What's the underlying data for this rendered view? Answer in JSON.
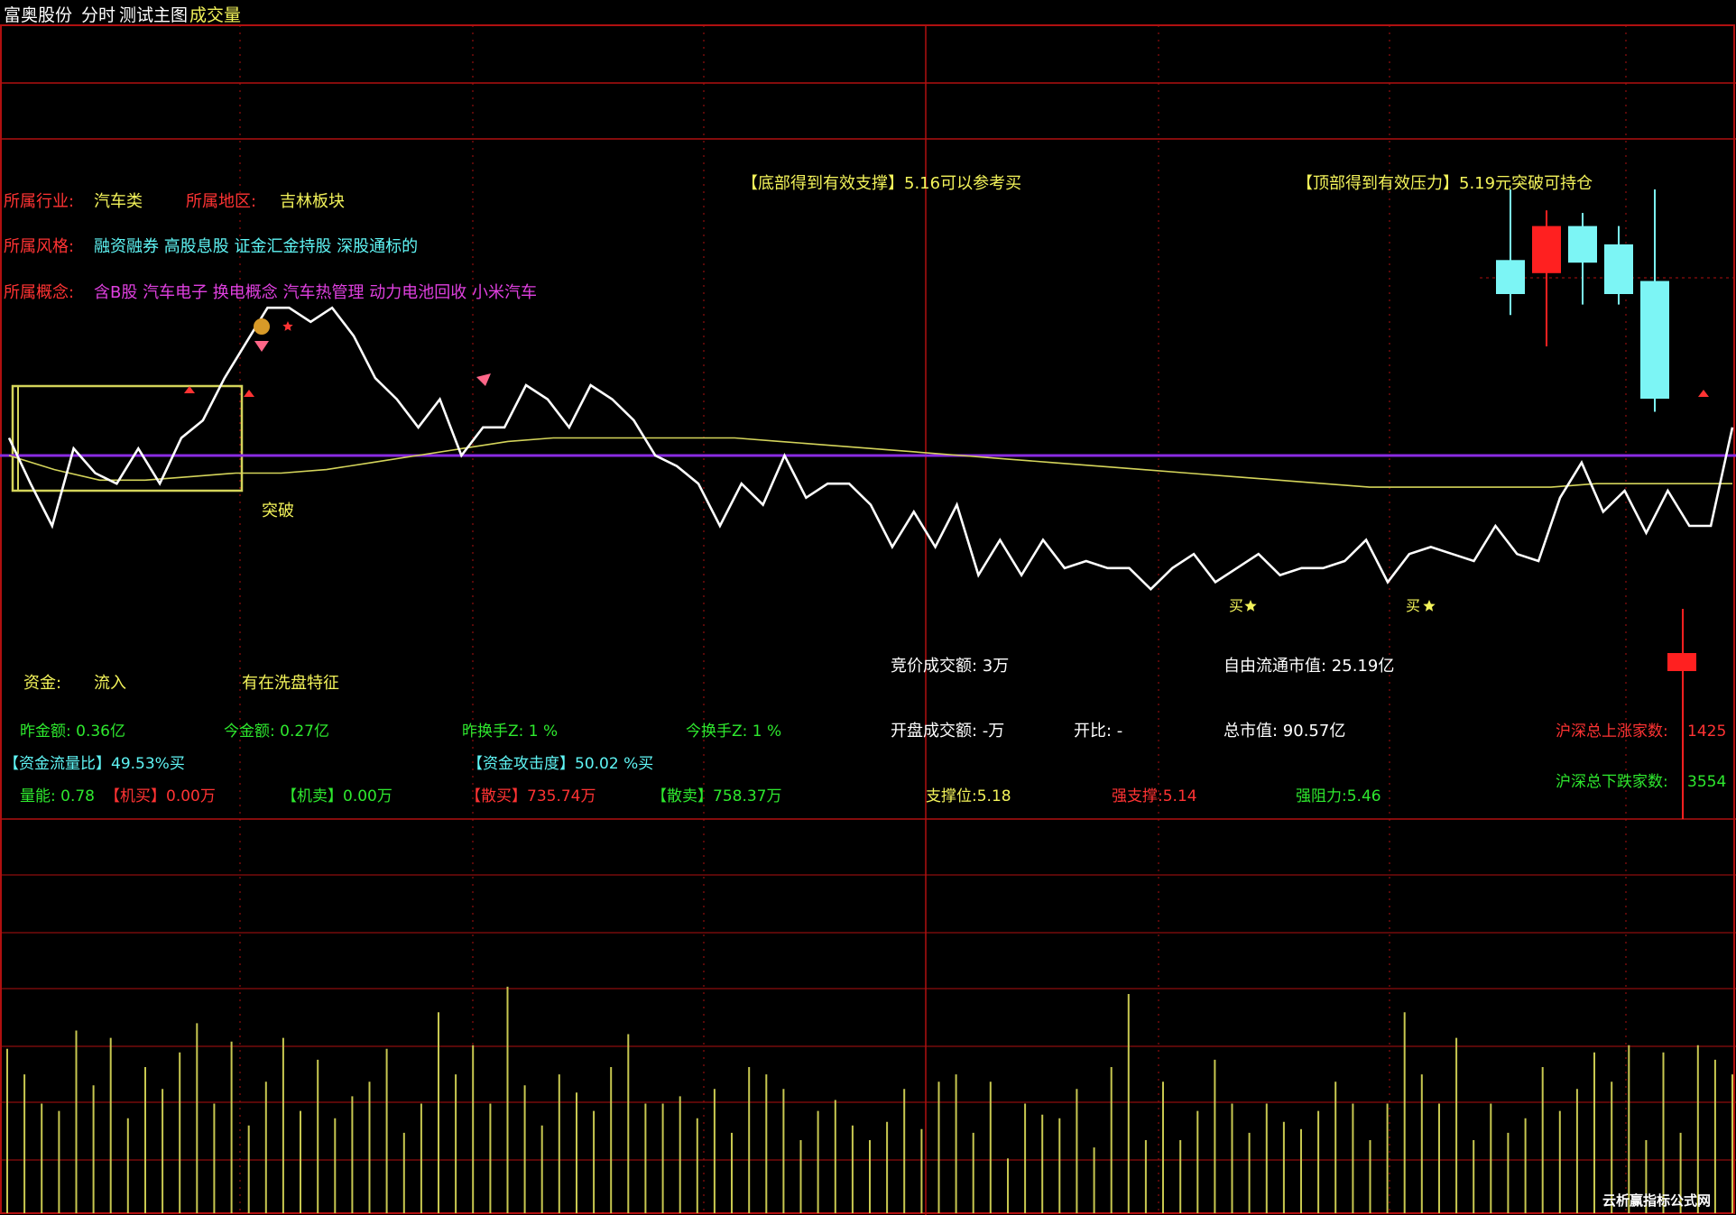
{
  "window": {
    "stock_name": "富奥股份",
    "menu": [
      "分时",
      "测试主图",
      "成交量"
    ]
  },
  "colors": {
    "bg": "#000000",
    "grid": "#b01010",
    "price_line": "#ffffff",
    "avg_line": "#d4d45a",
    "baseline": "#8a2be2",
    "up_candle": "#ff2020",
    "down_candle": "#7cf5f5",
    "volume_bar": "#c8c850",
    "label_red": "#ff3333",
    "label_yellow": "#f3f35a",
    "label_cyan": "#5ff5f5",
    "label_magenta": "#e040e0",
    "label_green": "#2ee82e",
    "label_white": "#ffffff"
  },
  "profile": {
    "industry_label": "所属行业:",
    "industry_value": "汽车类",
    "region_label": "所属地区:",
    "region_value": "吉林板块",
    "style_label": "所属风格:",
    "style_value": "融资融券 高股息股 证金汇金持股 深股通标的",
    "concept_label": "所属概念:",
    "concept_value": "含B股 汽车电子 换电概念 汽车热管理 动力电池回收 小米汽车"
  },
  "signals": {
    "support_note": "【底部得到有效支撑】5.16可以参考买",
    "resistance_note": "【顶部得到有效压力】5.19元突破可持仓",
    "breakout_label": "突破",
    "buy_label": "买"
  },
  "stats": {
    "funds_label": "资金:",
    "funds_value": "流入",
    "wash_note": "有在洗盘特征",
    "auction_amount": "竞价成交额: 3万",
    "float_mcap": "自由流通市值: 25.19亿",
    "yesterday_amount": "昨金额: 0.36亿",
    "today_amount": "今金额: 0.27亿",
    "yesterday_turnover": "昨换手Z: 1 %",
    "today_turnover": "今换手Z: 1 %",
    "open_amount": "开盘成交额: -万",
    "open_ratio": "开比: -",
    "total_mcap": "总市值: 90.57亿",
    "market_up_label": "沪深总上涨家数:",
    "market_up_value": "1425",
    "flow_ratio": "【资金流量比】49.53%买",
    "attack_ratio": "【资金攻击度】50.02 %买",
    "market_down_label": "沪深总下跌家数:",
    "market_down_value": "3554",
    "energy": "量能: 0.78",
    "inst_buy": "【机买】0.00万",
    "inst_sell": "【机卖】0.00万",
    "retail_buy": "【散买】735.74万",
    "retail_sell": "【散卖】758.37万",
    "support": "支撑位:5.18",
    "strong_support": "强支撑:5.14",
    "strong_resist": "强阻力:5.46"
  },
  "watermark": "云析赢指标公式网",
  "chart_data": [
    {
      "type": "line",
      "ylim": [
        0,
        100
      ],
      "price": [
        55,
        42,
        30,
        52,
        45,
        42,
        52,
        42,
        55,
        60,
        72,
        82,
        92,
        92,
        88,
        92,
        84,
        72,
        66,
        58,
        66,
        50,
        58,
        58,
        70,
        66,
        58,
        70,
        66,
        60,
        50,
        47,
        42,
        30,
        42,
        36,
        50,
        38,
        42,
        42,
        36,
        24,
        34,
        24,
        36,
        16,
        26,
        16,
        26,
        18,
        20,
        18,
        18,
        12,
        18,
        22,
        14,
        18,
        22,
        16,
        18,
        18,
        20,
        26,
        14,
        22,
        24,
        22,
        20,
        30,
        22,
        20,
        38,
        48,
        34,
        40,
        28,
        40,
        30,
        30,
        58
      ],
      "avg": [
        50,
        46,
        43,
        43,
        44,
        45,
        45,
        46,
        48,
        50,
        52,
        54,
        55,
        55,
        55,
        55,
        55,
        54,
        53,
        52,
        51,
        50,
        49,
        48,
        47,
        46,
        45,
        44,
        43,
        42,
        41,
        41,
        41,
        41,
        41,
        42,
        42,
        42,
        42
      ],
      "baseline": 50
    },
    {
      "type": "candlestick",
      "candles": [
        {
          "open": 60,
          "close": 73,
          "high": 100,
          "low": 52,
          "up": false
        },
        {
          "open": 68,
          "close": 86,
          "high": 92,
          "low": 40,
          "up": true
        },
        {
          "open": 72,
          "close": 86,
          "high": 91,
          "low": 56,
          "up": false
        },
        {
          "open": 60,
          "close": 79,
          "high": 86,
          "low": 56,
          "up": false
        },
        {
          "open": 20,
          "close": 65,
          "high": 100,
          "low": 15,
          "up": false
        }
      ]
    },
    {
      "type": "bar",
      "values": [
        45,
        38,
        30,
        28,
        50,
        35,
        48,
        26,
        40,
        34,
        44,
        52,
        30,
        47,
        24,
        36,
        48,
        28,
        42,
        26,
        32,
        36,
        45,
        22,
        30,
        55,
        38,
        46,
        30,
        62,
        35,
        24,
        38,
        33,
        28,
        40,
        49,
        30,
        30,
        32,
        26,
        34,
        22,
        40,
        38,
        34,
        20,
        28,
        31,
        24,
        20,
        25,
        34,
        23,
        36,
        38,
        22,
        36,
        15,
        30,
        27,
        26,
        34,
        18,
        40,
        60,
        20,
        36,
        20,
        28,
        42,
        30,
        22,
        30,
        25,
        23,
        28,
        36,
        30,
        20,
        30,
        55,
        38,
        30,
        48,
        20,
        30,
        22,
        26,
        40,
        28,
        34,
        44,
        36,
        46,
        20,
        44,
        22,
        46,
        42,
        38
      ]
    }
  ]
}
